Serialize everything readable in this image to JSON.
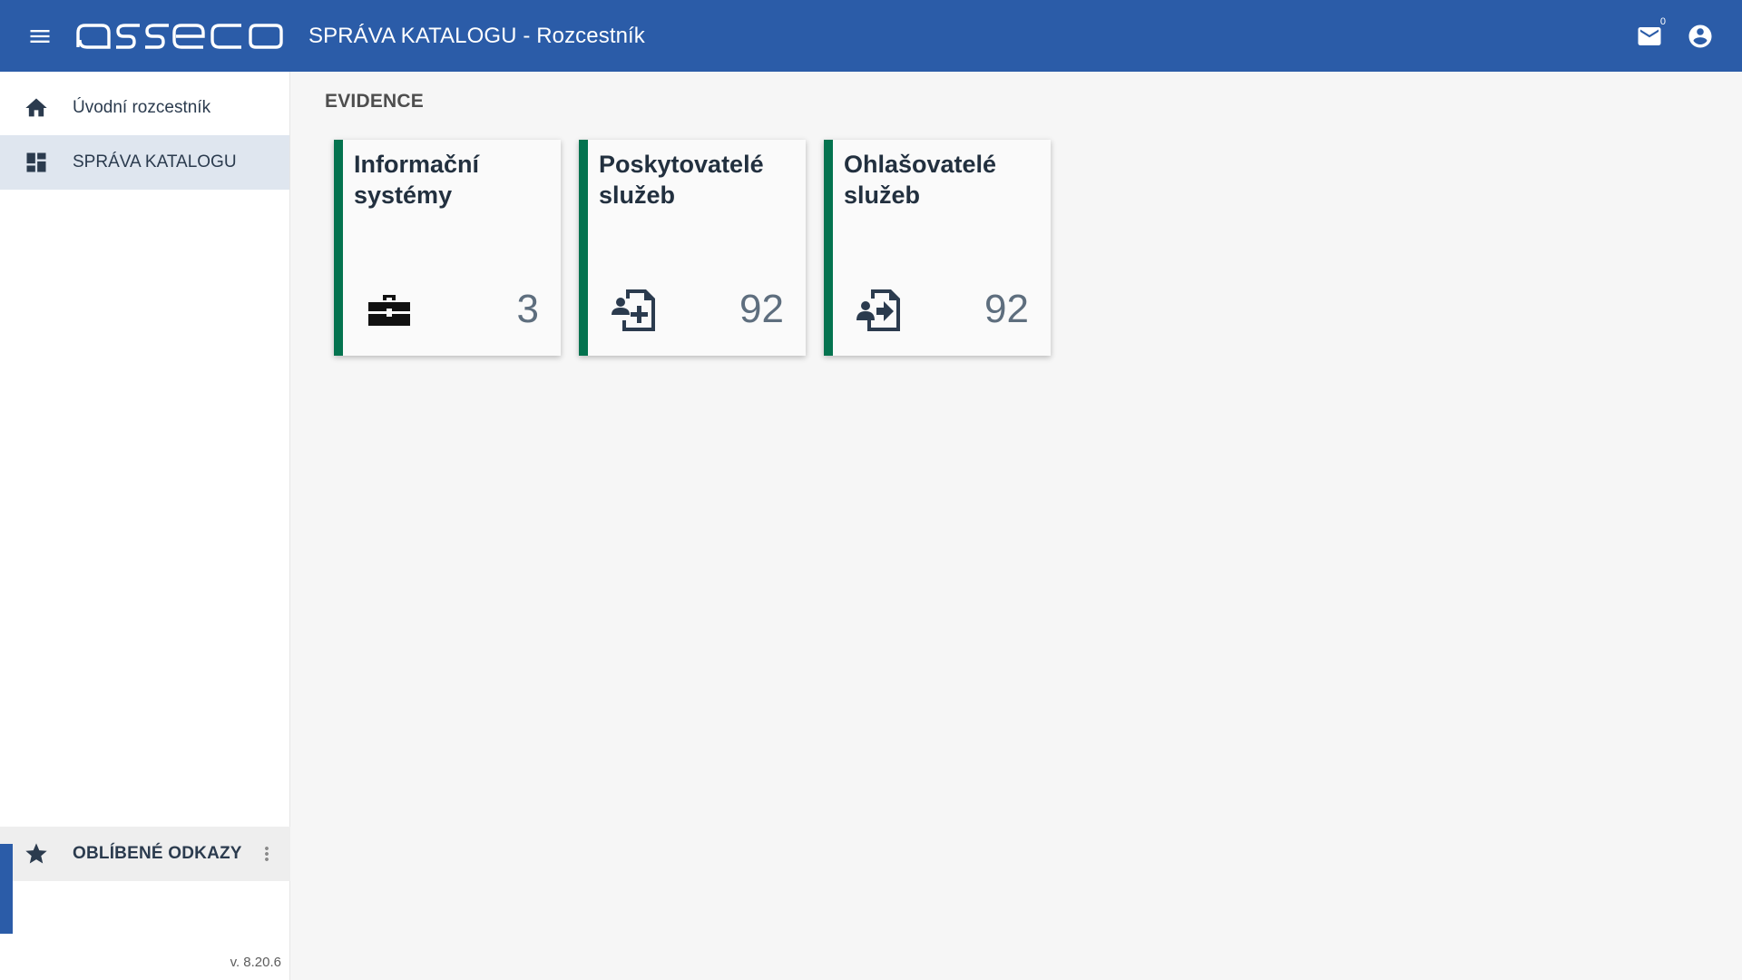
{
  "header": {
    "logo_text": "asseco",
    "title": "SPRÁVA KATALOGU - Rozcestník",
    "mail_count": "0",
    "icons": {
      "menu": "menu-icon",
      "mail": "mail-icon",
      "user": "account-circle-icon"
    }
  },
  "sidebar": {
    "items": [
      {
        "label": "Úvodní rozcestník",
        "icon": "home-icon",
        "active": false
      },
      {
        "label": "SPRÁVA KATALOGU",
        "icon": "dashboard-icon",
        "active": true
      }
    ],
    "favorites_label": "OBLÍBENÉ ODKAZY",
    "version": "v. 8.20.6"
  },
  "main": {
    "section_title": "EVIDENCE",
    "cards": [
      {
        "title": "Informační systémy",
        "count": "3",
        "icon": "toolbox-icon"
      },
      {
        "title": "Poskytovatelé služeb",
        "count": "92",
        "icon": "document-person-add-icon"
      },
      {
        "title": "Ohlašovatelé služeb",
        "count": "92",
        "icon": "document-person-send-icon"
      }
    ]
  },
  "colors": {
    "header": "#2b5ca8",
    "card_accent": "#04734f",
    "active_nav": "#dfe6ef",
    "text_dark": "#2b3b4e"
  }
}
